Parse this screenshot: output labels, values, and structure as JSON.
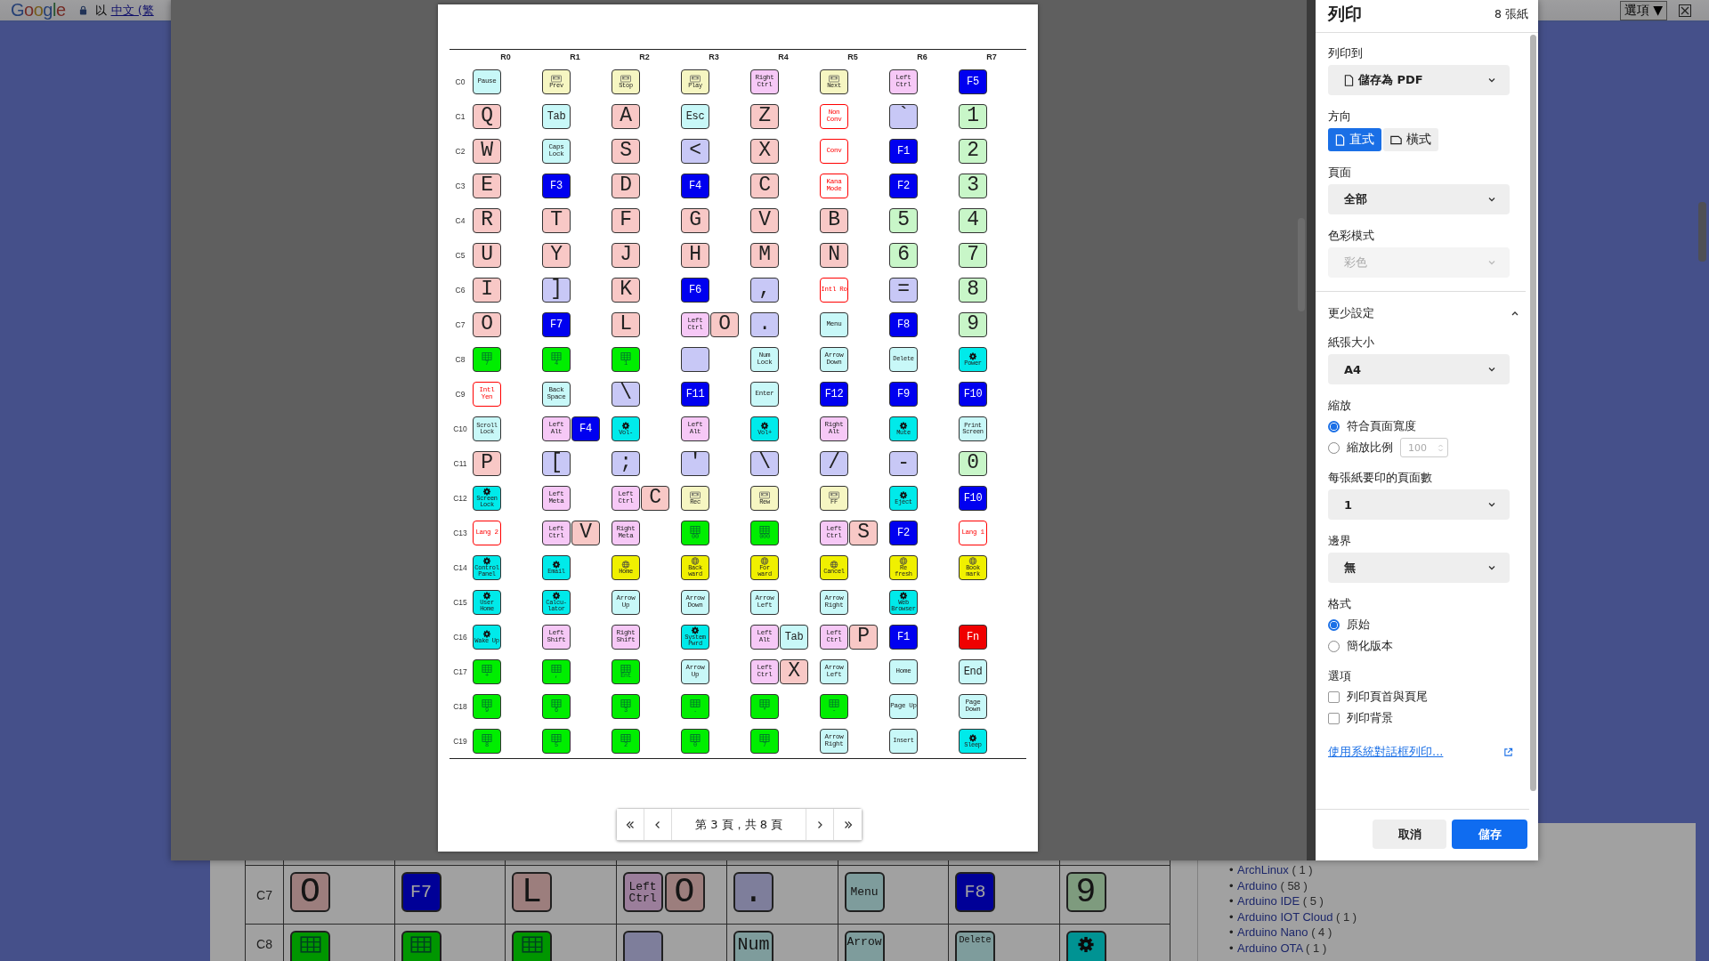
{
  "background_page": {
    "top_bar": {
      "logo": "Google",
      "prefix": "以",
      "language_link": "中文 (繁",
      "options_button": "選項 ▼"
    },
    "table": {
      "rows": [
        {
          "label": "C7",
          "cells": [
            [
              {
                "label": "O",
                "kind": "alpha"
              }
            ],
            [
              {
                "label": "F7",
                "kind": "fkey"
              }
            ],
            [
              {
                "label": "L",
                "kind": "alpha"
              }
            ],
            [
              {
                "label": "Left Ctrl",
                "kind": "mod"
              },
              {
                "label": "O",
                "kind": "alpha"
              }
            ],
            [
              {
                "label": ".",
                "kind": "sym"
              }
            ],
            [
              {
                "label": "Menu",
                "kind": "nav"
              }
            ],
            [
              {
                "label": "F8",
                "kind": "fkey"
              }
            ],
            [
              {
                "label": "9",
                "kind": "num"
              }
            ]
          ]
        },
        {
          "label": "C8",
          "cells": [
            [
              {
                "kind": "pad"
              }
            ],
            [
              {
                "kind": "pad"
              }
            ],
            [
              {
                "kind": "pad"
              }
            ],
            [
              {
                "kind": "sym"
              }
            ],
            [
              {
                "label": "Num",
                "kind": "nav"
              }
            ],
            [
              {
                "label": "Arrow",
                "kind": "nav"
              }
            ],
            [
              {
                "label": "Delete",
                "kind": "nav"
              }
            ],
            [
              {
                "kind": "sys"
              }
            ]
          ]
        }
      ]
    },
    "categories": [
      {
        "bullet": "•",
        "name": "ArchLinux",
        "count": "( 1 )"
      },
      {
        "bullet": "•",
        "name": "Arduino",
        "count": "( 58 )"
      },
      {
        "bullet": "•",
        "name": "Arduino IDE",
        "count": "( 5 )"
      },
      {
        "bullet": "•",
        "name": "Arduino IOT Cloud",
        "count": "( 1 )"
      },
      {
        "bullet": "•",
        "name": "Arduino Nano",
        "count": "( 4 )"
      },
      {
        "bullet": "•",
        "name": "Arduino OTA",
        "count": "( 1 )"
      }
    ]
  },
  "print_preview": {
    "matrix": {
      "columns": [
        "R0",
        "R1",
        "R2",
        "R3",
        "R4",
        "R5",
        "R6",
        "R7"
      ],
      "rows": [
        {
          "label": "C0",
          "cells": [
            [
              {
                "label": "Pause",
                "kind": "nav"
              }
            ],
            [
              {
                "label": "Prev",
                "kind": "media"
              }
            ],
            [
              {
                "label": "Stop",
                "kind": "media"
              }
            ],
            [
              {
                "label": "Play",
                "kind": "media"
              }
            ],
            [
              {
                "label": "Right Ctrl",
                "kind": "mod"
              }
            ],
            [
              {
                "label": "Next",
                "kind": "media"
              }
            ],
            [
              {
                "label": "Left Ctrl",
                "kind": "mod"
              }
            ],
            [
              {
                "label": "F5",
                "kind": "fkey"
              }
            ]
          ]
        },
        {
          "label": "C1",
          "cells": [
            [
              {
                "label": "Q",
                "kind": "alpha"
              }
            ],
            [
              {
                "label": "Tab",
                "kind": "nav"
              }
            ],
            [
              {
                "label": "A",
                "kind": "alpha"
              }
            ],
            [
              {
                "label": "Esc",
                "kind": "nav"
              }
            ],
            [
              {
                "label": "Z",
                "kind": "alpha"
              }
            ],
            [
              {
                "label": "Non Conv",
                "kind": "intl"
              }
            ],
            [
              {
                "label": "`",
                "kind": "sym"
              }
            ],
            [
              {
                "label": "1",
                "kind": "num"
              }
            ]
          ]
        },
        {
          "label": "C2",
          "cells": [
            [
              {
                "label": "W",
                "kind": "alpha"
              }
            ],
            [
              {
                "label": "Caps Lock",
                "kind": "nav"
              }
            ],
            [
              {
                "label": "S",
                "kind": "alpha"
              }
            ],
            [
              {
                "label": "<",
                "kind": "sym"
              }
            ],
            [
              {
                "label": "X",
                "kind": "alpha"
              }
            ],
            [
              {
                "label": "Conv",
                "kind": "intl"
              }
            ],
            [
              {
                "label": "F1",
                "kind": "fkey"
              }
            ],
            [
              {
                "label": "2",
                "kind": "num"
              }
            ]
          ]
        },
        {
          "label": "C3",
          "cells": [
            [
              {
                "label": "E",
                "kind": "alpha"
              }
            ],
            [
              {
                "label": "F3",
                "kind": "fkey"
              }
            ],
            [
              {
                "label": "D",
                "kind": "alpha"
              }
            ],
            [
              {
                "label": "F4",
                "kind": "fkey"
              }
            ],
            [
              {
                "label": "C",
                "kind": "alpha"
              }
            ],
            [
              {
                "label": "Kana Mode",
                "kind": "intl"
              }
            ],
            [
              {
                "label": "F2",
                "kind": "fkey"
              }
            ],
            [
              {
                "label": "3",
                "kind": "num"
              }
            ]
          ]
        },
        {
          "label": "C4",
          "cells": [
            [
              {
                "label": "R",
                "kind": "alpha"
              }
            ],
            [
              {
                "label": "T",
                "kind": "alpha"
              }
            ],
            [
              {
                "label": "F",
                "kind": "alpha"
              }
            ],
            [
              {
                "label": "G",
                "kind": "alpha"
              }
            ],
            [
              {
                "label": "V",
                "kind": "alpha"
              }
            ],
            [
              {
                "label": "B",
                "kind": "alpha"
              }
            ],
            [
              {
                "label": "5",
                "kind": "num"
              }
            ],
            [
              {
                "label": "4",
                "kind": "num"
              }
            ]
          ]
        },
        {
          "label": "C5",
          "cells": [
            [
              {
                "label": "U",
                "kind": "alpha"
              }
            ],
            [
              {
                "label": "Y",
                "kind": "alpha"
              }
            ],
            [
              {
                "label": "J",
                "kind": "alpha"
              }
            ],
            [
              {
                "label": "H",
                "kind": "alpha"
              }
            ],
            [
              {
                "label": "M",
                "kind": "alpha"
              }
            ],
            [
              {
                "label": "N",
                "kind": "alpha"
              }
            ],
            [
              {
                "label": "6",
                "kind": "num"
              }
            ],
            [
              {
                "label": "7",
                "kind": "num"
              }
            ]
          ]
        },
        {
          "label": "C6",
          "cells": [
            [
              {
                "label": "I",
                "kind": "alpha"
              }
            ],
            [
              {
                "label": "]",
                "kind": "sym"
              }
            ],
            [
              {
                "label": "K",
                "kind": "alpha"
              }
            ],
            [
              {
                "label": "F6",
                "kind": "fkey"
              }
            ],
            [
              {
                "label": ",",
                "kind": "sym"
              }
            ],
            [
              {
                "label": "Intl Ro",
                "kind": "intl"
              }
            ],
            [
              {
                "label": "=",
                "kind": "sym"
              }
            ],
            [
              {
                "label": "8",
                "kind": "num"
              }
            ]
          ]
        },
        {
          "label": "C7",
          "cells": [
            [
              {
                "label": "O",
                "kind": "alpha"
              }
            ],
            [
              {
                "label": "F7",
                "kind": "fkey"
              }
            ],
            [
              {
                "label": "L",
                "kind": "alpha"
              }
            ],
            [
              {
                "label": "Left Ctrl",
                "kind": "mod"
              },
              {
                "label": "O",
                "kind": "alpha"
              }
            ],
            [
              {
                "label": ".",
                "kind": "sym"
              }
            ],
            [
              {
                "label": "Menu",
                "kind": "nav"
              }
            ],
            [
              {
                "label": "F8",
                "kind": "fkey"
              }
            ],
            [
              {
                "label": "9",
                "kind": "num"
              }
            ]
          ]
        },
        {
          "label": "C8",
          "cells": [
            [
              {
                "label": "7",
                "kind": "pad"
              }
            ],
            [
              {
                "label": "4",
                "kind": "pad"
              }
            ],
            [
              {
                "label": "1",
                "kind": "pad"
              }
            ],
            [
              {
                "kind": "sym"
              }
            ],
            [
              {
                "label": "Num Lock",
                "kind": "nav"
              }
            ],
            [
              {
                "label": "Arrow Down",
                "kind": "nav"
              }
            ],
            [
              {
                "label": "Delete",
                "kind": "nav"
              }
            ],
            [
              {
                "label": "Power",
                "kind": "sys"
              }
            ]
          ]
        },
        {
          "label": "C9",
          "cells": [
            [
              {
                "label": "Intl Yen",
                "kind": "intl"
              }
            ],
            [
              {
                "label": "Back Space",
                "kind": "nav"
              }
            ],
            [
              {
                "label": "\\",
                "kind": "sym"
              }
            ],
            [
              {
                "label": "F11",
                "kind": "fkey"
              }
            ],
            [
              {
                "label": "Enter",
                "kind": "nav"
              }
            ],
            [
              {
                "label": "F12",
                "kind": "fkey"
              }
            ],
            [
              {
                "label": "F9",
                "kind": "fkey"
              }
            ],
            [
              {
                "label": "F10",
                "kind": "fkey"
              }
            ]
          ]
        },
        {
          "label": "C10",
          "cells": [
            [
              {
                "label": "Scroll Lock",
                "kind": "nav"
              }
            ],
            [
              {
                "label": "Left Alt",
                "kind": "mod"
              },
              {
                "label": "F4",
                "kind": "fkey"
              }
            ],
            [
              {
                "label": "Vol-",
                "kind": "sys"
              }
            ],
            [
              {
                "label": "Left Alt",
                "kind": "mod"
              }
            ],
            [
              {
                "label": "Vol+",
                "kind": "sys"
              }
            ],
            [
              {
                "label": "Right Alt",
                "kind": "mod"
              }
            ],
            [
              {
                "label": "Mute",
                "kind": "sys"
              }
            ],
            [
              {
                "label": "Print Screen",
                "kind": "nav"
              }
            ]
          ]
        },
        {
          "label": "C11",
          "cells": [
            [
              {
                "label": "P",
                "kind": "alpha"
              }
            ],
            [
              {
                "label": "[",
                "kind": "sym"
              }
            ],
            [
              {
                "label": ";",
                "kind": "sym"
              }
            ],
            [
              {
                "label": "'",
                "kind": "sym"
              }
            ],
            [
              {
                "label": "\\",
                "kind": "sym"
              }
            ],
            [
              {
                "label": "/",
                "kind": "sym"
              }
            ],
            [
              {
                "label": "-",
                "kind": "sym"
              }
            ],
            [
              {
                "label": "0",
                "kind": "num"
              }
            ]
          ]
        },
        {
          "label": "C12",
          "cells": [
            [
              {
                "label": "Screen Lock",
                "kind": "sys"
              }
            ],
            [
              {
                "label": "Left Meta",
                "kind": "mod"
              }
            ],
            [
              {
                "label": "Left Ctrl",
                "kind": "mod"
              },
              {
                "label": "C",
                "kind": "alpha"
              }
            ],
            [
              {
                "label": "Rec",
                "kind": "media"
              }
            ],
            [
              {
                "label": "Rew",
                "kind": "media"
              }
            ],
            [
              {
                "label": "FF",
                "kind": "media"
              }
            ],
            [
              {
                "label": "Eject",
                "kind": "sys"
              }
            ],
            [
              {
                "label": "F10",
                "kind": "fkey"
              }
            ]
          ]
        },
        {
          "label": "C13",
          "cells": [
            [
              {
                "label": "Lang 2",
                "kind": "intl"
              }
            ],
            [
              {
                "label": "Left Ctrl",
                "kind": "mod"
              },
              {
                "label": "V",
                "kind": "alpha"
              }
            ],
            [
              {
                "label": "Right Meta",
                "kind": "mod"
              }
            ],
            [
              {
                "label": "00",
                "kind": "pad"
              }
            ],
            [
              {
                "label": "000",
                "kind": "pad"
              }
            ],
            [
              {
                "label": "Left Ctrl",
                "kind": "mod"
              },
              {
                "label": "S",
                "kind": "alpha"
              }
            ],
            [
              {
                "label": "F2",
                "kind": "fkey"
              }
            ],
            [
              {
                "label": "Lang 1",
                "kind": "intl"
              }
            ]
          ]
        },
        {
          "label": "C14",
          "cells": [
            [
              {
                "label": "Control Panel",
                "kind": "sys"
              }
            ],
            [
              {
                "label": "Email",
                "kind": "sys"
              }
            ],
            [
              {
                "label": "Home",
                "kind": "web"
              }
            ],
            [
              {
                "label": "Back ward",
                "kind": "web"
              }
            ],
            [
              {
                "label": "For ward",
                "kind": "web"
              }
            ],
            [
              {
                "label": "Cancel",
                "kind": "web"
              }
            ],
            [
              {
                "label": "Re fresh",
                "kind": "web"
              }
            ],
            [
              {
                "label": "Book mark",
                "kind": "web"
              }
            ]
          ]
        },
        {
          "label": "C15",
          "cells": [
            [
              {
                "label": "User Home",
                "kind": "sys"
              }
            ],
            [
              {
                "label": "Calcu- lator",
                "kind": "sys"
              }
            ],
            [
              {
                "label": "Arrow Up",
                "kind": "nav"
              }
            ],
            [
              {
                "label": "Arrow Down",
                "kind": "nav"
              }
            ],
            [
              {
                "label": "Arrow Left",
                "kind": "nav"
              }
            ],
            [
              {
                "label": "Arrow Right",
                "kind": "nav"
              }
            ],
            [
              {
                "label": "Web Browser",
                "kind": "sys"
              }
            ],
            []
          ]
        },
        {
          "label": "C16",
          "cells": [
            [
              {
                "label": "Wake Up",
                "kind": "sys"
              }
            ],
            [
              {
                "label": "Left Shift",
                "kind": "mod"
              }
            ],
            [
              {
                "label": "Right Shift",
                "kind": "mod"
              }
            ],
            [
              {
                "label": "System Pwrd",
                "kind": "sys"
              }
            ],
            [
              {
                "label": "Left Alt",
                "kind": "mod"
              },
              {
                "label": "Tab",
                "kind": "nav"
              }
            ],
            [
              {
                "label": "Left Ctrl",
                "kind": "mod"
              },
              {
                "label": "P",
                "kind": "alpha"
              }
            ],
            [
              {
                "label": "F1",
                "kind": "fkey"
              }
            ],
            [
              {
                "label": "Fn",
                "kind": "fn"
              }
            ]
          ]
        },
        {
          "label": "C17",
          "cells": [
            [
              {
                "label": "+",
                "kind": "pad"
              }
            ],
            [
              {
                "label": ",",
                "kind": "pad"
              }
            ],
            [
              {
                "label": "Ent",
                "kind": "pad"
              }
            ],
            [
              {
                "label": "Arrow Up",
                "kind": "nav"
              }
            ],
            [
              {
                "label": "Left Ctrl",
                "kind": "mod"
              },
              {
                "label": "X",
                "kind": "alpha"
              }
            ],
            [
              {
                "label": "Arrow Left",
                "kind": "nav"
              }
            ],
            [
              {
                "label": "Home",
                "kind": "nav"
              }
            ],
            [
              {
                "label": "End",
                "kind": "nav"
              }
            ]
          ]
        },
        {
          "label": "C18",
          "cells": [
            [
              {
                "label": "9",
                "kind": "pad"
              }
            ],
            [
              {
                "label": "6",
                "kind": "pad"
              }
            ],
            [
              {
                "label": "3",
                "kind": "pad"
              }
            ],
            [
              {
                "label": ".",
                "kind": "pad"
              }
            ],
            [
              {
                "label": "*",
                "kind": "pad"
              }
            ],
            [
              {
                "label": "-",
                "kind": "pad"
              }
            ],
            [
              {
                "label": "Page Up",
                "kind": "nav"
              }
            ],
            [
              {
                "label": "Page Down",
                "kind": "nav"
              }
            ]
          ]
        },
        {
          "label": "C19",
          "cells": [
            [
              {
                "label": "8",
                "kind": "pad"
              }
            ],
            [
              {
                "label": "5",
                "kind": "pad"
              }
            ],
            [
              {
                "label": "2",
                "kind": "pad"
              }
            ],
            [
              {
                "label": "0",
                "kind": "pad"
              }
            ],
            [
              {
                "label": "7",
                "kind": "pad"
              }
            ],
            [
              {
                "label": "Arrow Right",
                "kind": "nav"
              }
            ],
            [
              {
                "label": "Insert",
                "kind": "nav"
              }
            ],
            [
              {
                "label": "Sleep",
                "kind": "sys"
              }
            ]
          ]
        }
      ]
    },
    "page_label": "第 3 頁，共 8 頁"
  },
  "sidebar": {
    "title": "列印",
    "sheet_count": "8 張紙",
    "sections": [
      {
        "kind": "destination",
        "label": "列印到",
        "value": "儲存為 PDF"
      },
      {
        "kind": "segmented",
        "label": "方向",
        "options": [
          {
            "label": "直式",
            "selected": true
          },
          {
            "label": "橫式",
            "selected": false
          }
        ]
      },
      {
        "kind": "select",
        "label": "頁面",
        "value": "全部",
        "disabled": false
      },
      {
        "kind": "select",
        "label": "色彩模式",
        "value": "彩色",
        "disabled": true
      },
      {
        "kind": "expander",
        "label": "更少設定",
        "expanded": true
      },
      {
        "kind": "select",
        "label": "紙張大小",
        "value": "A4",
        "disabled": false
      },
      {
        "kind": "radio",
        "label": "縮放",
        "options": [
          {
            "label": "符合頁面寬度",
            "selected": true
          },
          {
            "label": "縮放比例",
            "selected": false,
            "field": {
              "value": "100",
              "disabled": true
            }
          }
        ]
      },
      {
        "kind": "select",
        "label": "每張紙要印的頁面數",
        "value": "1",
        "disabled": false
      },
      {
        "kind": "select",
        "label": "邊界",
        "value": "無",
        "disabled": false
      },
      {
        "kind": "radio",
        "label": "格式",
        "options": [
          {
            "label": "原始",
            "selected": true
          },
          {
            "label": "簡化版本",
            "selected": false
          }
        ]
      },
      {
        "kind": "checkbox",
        "label": "選項",
        "items": [
          {
            "label": "列印頁首與頁尾",
            "checked": false
          },
          {
            "label": "列印背景",
            "checked": false
          }
        ]
      }
    ],
    "system_dialog_link": "使用系統對話框列印...",
    "buttons": [
      {
        "label": "取消",
        "kind": "secondary"
      },
      {
        "label": "儲存",
        "kind": "primary"
      }
    ]
  }
}
